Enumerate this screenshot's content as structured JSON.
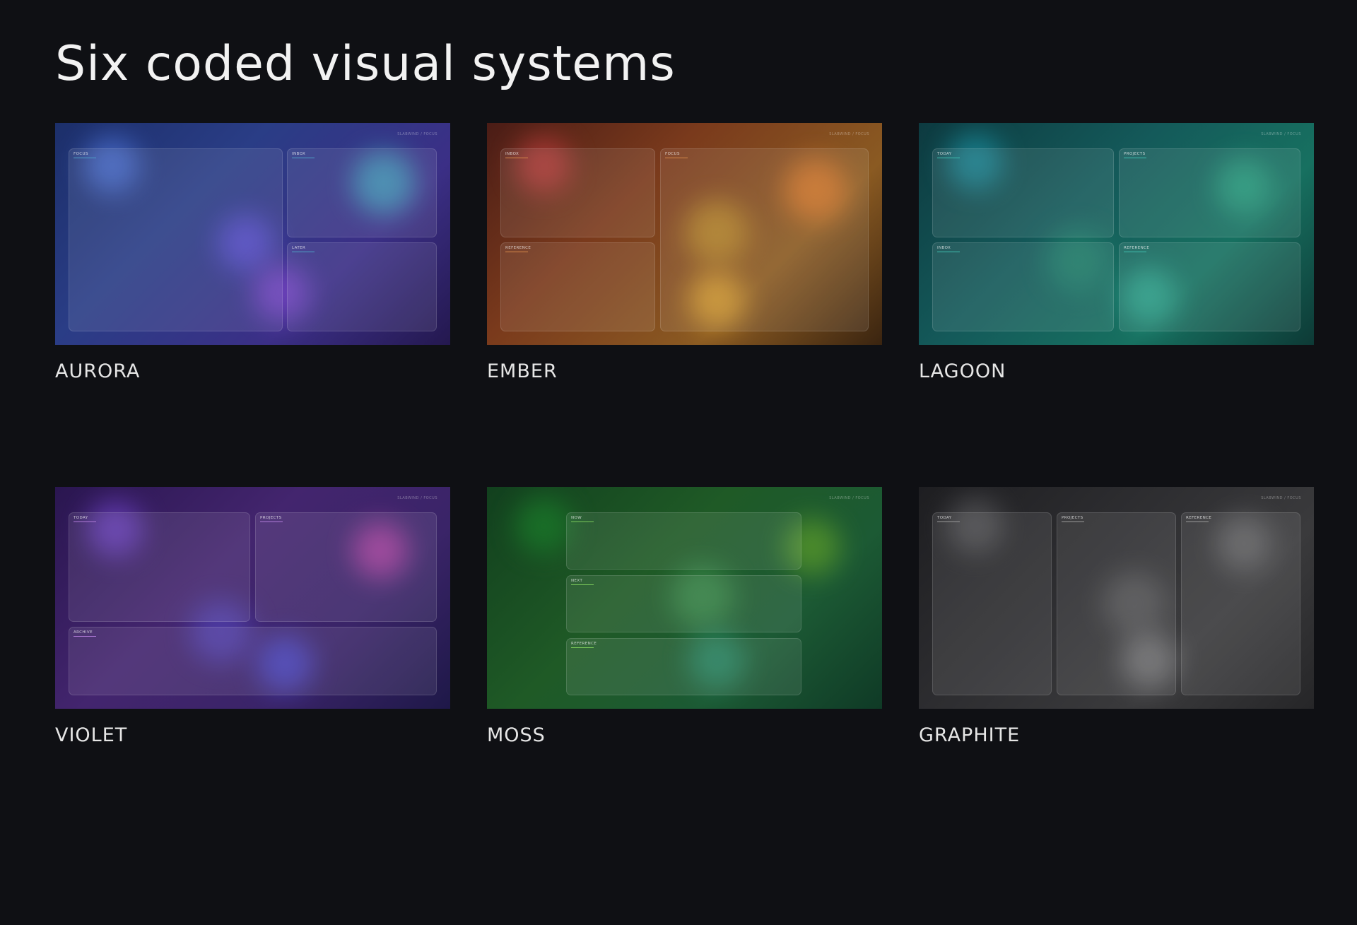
{
  "page": {
    "title": "Six coded visual systems"
  },
  "systems": [
    {
      "label": "AURORA",
      "brand": "SLABWIND / FOCUS",
      "accent": "#4fa3c7",
      "background": "linear-gradient(135deg, #1c2f6a 0%, #2a3d86 35%, #3b2f86 70%, #24184f 100%)",
      "orbs": [
        "#4a6fd0",
        "#3fa0b8",
        "#5a4fd0",
        "#7a45c8"
      ],
      "panels": [
        {
          "title": "FOCUS"
        },
        {
          "title": "INBOX"
        },
        {
          "title": "LATER"
        }
      ]
    },
    {
      "label": "EMBER",
      "brand": "SLABWIND / FOCUS",
      "accent": "#d88a4a",
      "background": "linear-gradient(135deg, #4a1c16 0%, #7a3a1c 35%, #8a5a22 70%, #3a2410 100%)",
      "orbs": [
        "#b83a3a",
        "#d8782a",
        "#b88a2a",
        "#d8a030"
      ],
      "panels": [
        {
          "title": "INBOX"
        },
        {
          "title": "FOCUS"
        },
        {
          "title": "REFERENCE"
        }
      ]
    },
    {
      "label": "LAGOON",
      "brand": "SLABWIND / FOCUS",
      "accent": "#3fc0b0",
      "background": "linear-gradient(135deg, #0d3a40 0%, #145a5a 40%, #177060 70%, #0d3a36 100%)",
      "orbs": [
        "#1a8a9a",
        "#2aa080",
        "#20806a",
        "#30a890"
      ],
      "panels": [
        {
          "title": "TODAY"
        },
        {
          "title": "PROJECTS"
        },
        {
          "title": "INBOX"
        },
        {
          "title": "REFERENCE"
        }
      ]
    },
    {
      "label": "VIOLET",
      "brand": "SLABWIND / FOCUS",
      "accent": "#b07ad8",
      "background": "linear-gradient(135deg, #2a1650 0%, #43256e 40%, #3a2468 70%, #1e1848 100%)",
      "orbs": [
        "#6a40c0",
        "#b040a0",
        "#5040b0",
        "#4a48c8"
      ],
      "panels": [
        {
          "title": "TODAY"
        },
        {
          "title": "PROJECTS"
        },
        {
          "title": "ARCHIVE"
        }
      ]
    },
    {
      "label": "MOSS",
      "brand": "SLABWIND / FOCUS",
      "accent": "#7ac85a",
      "background": "linear-gradient(135deg, #12401e 0%, #1f5a26 40%, #1c5a34 70%, #0f3a26 100%)",
      "orbs": [
        "#1a7a2a",
        "#5a9a2a",
        "#3a8a4a",
        "#2a8a6a"
      ],
      "panels": [
        {
          "title": "NOW"
        },
        {
          "title": "NEXT"
        },
        {
          "title": "REFERENCE"
        }
      ]
    },
    {
      "label": "GRAPHITE",
      "brand": "SLABWIND / FOCUS",
      "accent": "#9a9a9a",
      "background": "linear-gradient(135deg, #1e1e21 0%, #2e2e31 40%, #3a3a3c 70%, #262628 100%)",
      "orbs": [
        "#555558",
        "#6a6a6c",
        "#5a5a5c",
        "#7a7a7c"
      ],
      "panels": [
        {
          "title": "TODAY"
        },
        {
          "title": "PROJECTS"
        },
        {
          "title": "REFERENCE"
        }
      ]
    }
  ]
}
